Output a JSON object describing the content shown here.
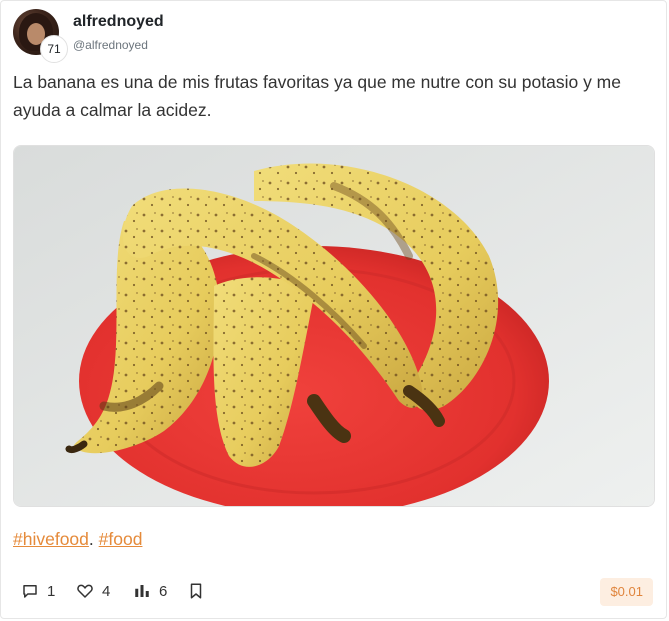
{
  "post": {
    "author": {
      "username": "alfrednoyed",
      "handle": "@alfrednoyed",
      "reputation": "71"
    },
    "body": "La banana es una de mis frutas favoritas ya que me nutre con su potasio y me ayuda a calmar la acidez.",
    "tags": [
      "#hivefood",
      "#food"
    ],
    "tag_separator": ". ",
    "stats": {
      "comments": "1",
      "likes": "4",
      "views": "6"
    },
    "payout": "$0.01"
  },
  "icons": {
    "comment": "comment-icon",
    "like": "heart-icon",
    "views": "bar-chart-icon",
    "bookmark": "bookmark-icon"
  },
  "colors": {
    "tag": "#e58a3a",
    "payout_bg": "#fdeee1",
    "payout_text": "#e0853d"
  }
}
